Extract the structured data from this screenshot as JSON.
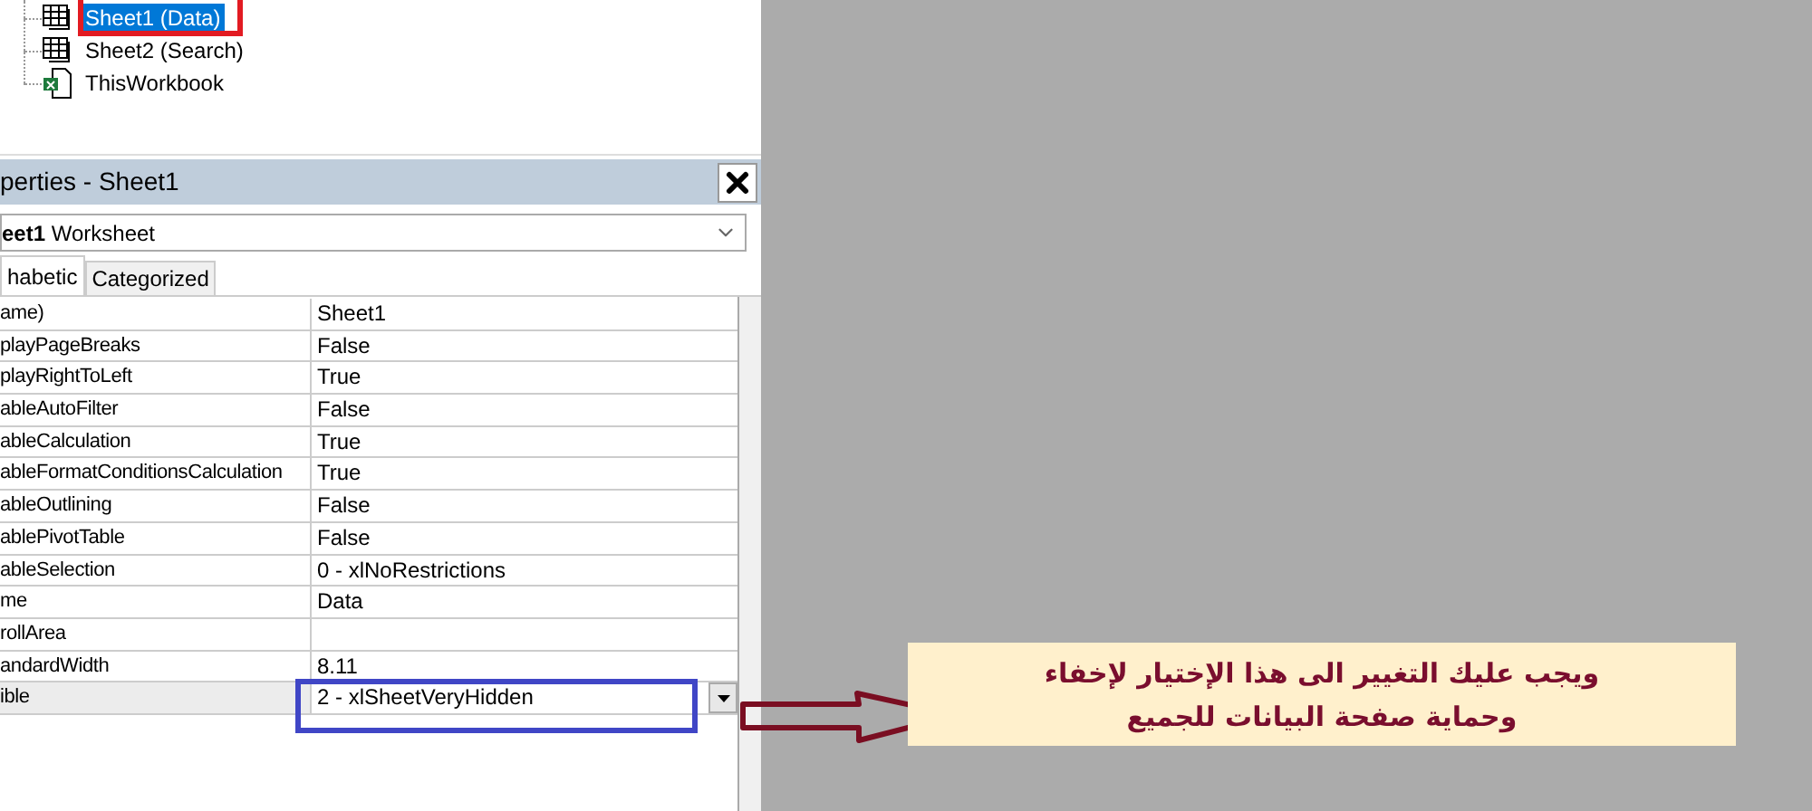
{
  "project_tree": {
    "items": [
      {
        "label": "Sheet1 (Data)",
        "kind": "sheet",
        "selected": true
      },
      {
        "label": "Sheet2 (Search)",
        "kind": "sheet",
        "selected": false
      },
      {
        "label": "ThisWorkbook",
        "kind": "workbook",
        "selected": false
      }
    ]
  },
  "properties": {
    "title": "perties - Sheet1",
    "object": {
      "name": "eet1",
      "type": "Worksheet"
    },
    "tabs": [
      {
        "label": "habetic",
        "selected": true
      },
      {
        "label": "Categorized",
        "selected": false
      }
    ],
    "rows": [
      {
        "name": "ame)",
        "value": "Sheet1",
        "selected": false
      },
      {
        "name": "playPageBreaks",
        "value": "False",
        "selected": false
      },
      {
        "name": "playRightToLeft",
        "value": "True",
        "selected": false
      },
      {
        "name": "ableAutoFilter",
        "value": "False",
        "selected": false
      },
      {
        "name": "ableCalculation",
        "value": "True",
        "selected": false
      },
      {
        "name": "ableFormatConditionsCalculation",
        "value": "True",
        "selected": false
      },
      {
        "name": "ableOutlining",
        "value": "False",
        "selected": false
      },
      {
        "name": "ablePivotTable",
        "value": "False",
        "selected": false
      },
      {
        "name": "ableSelection",
        "value": "0 - xlNoRestrictions",
        "selected": false
      },
      {
        "name": "me",
        "value": "Data",
        "selected": false
      },
      {
        "name": "rollArea",
        "selected": false
      },
      {
        "name": "andardWidth",
        "value": "8.11",
        "selected": false
      },
      {
        "name": "ible",
        "value": "2 - xlSheetVeryHidden",
        "selected": true
      }
    ]
  },
  "annotation": {
    "lines": [
      "ويجب عليك التغيير الى هذا الإختيار لإخفاء",
      "وحماية صفحة البيانات للجميع"
    ]
  }
}
